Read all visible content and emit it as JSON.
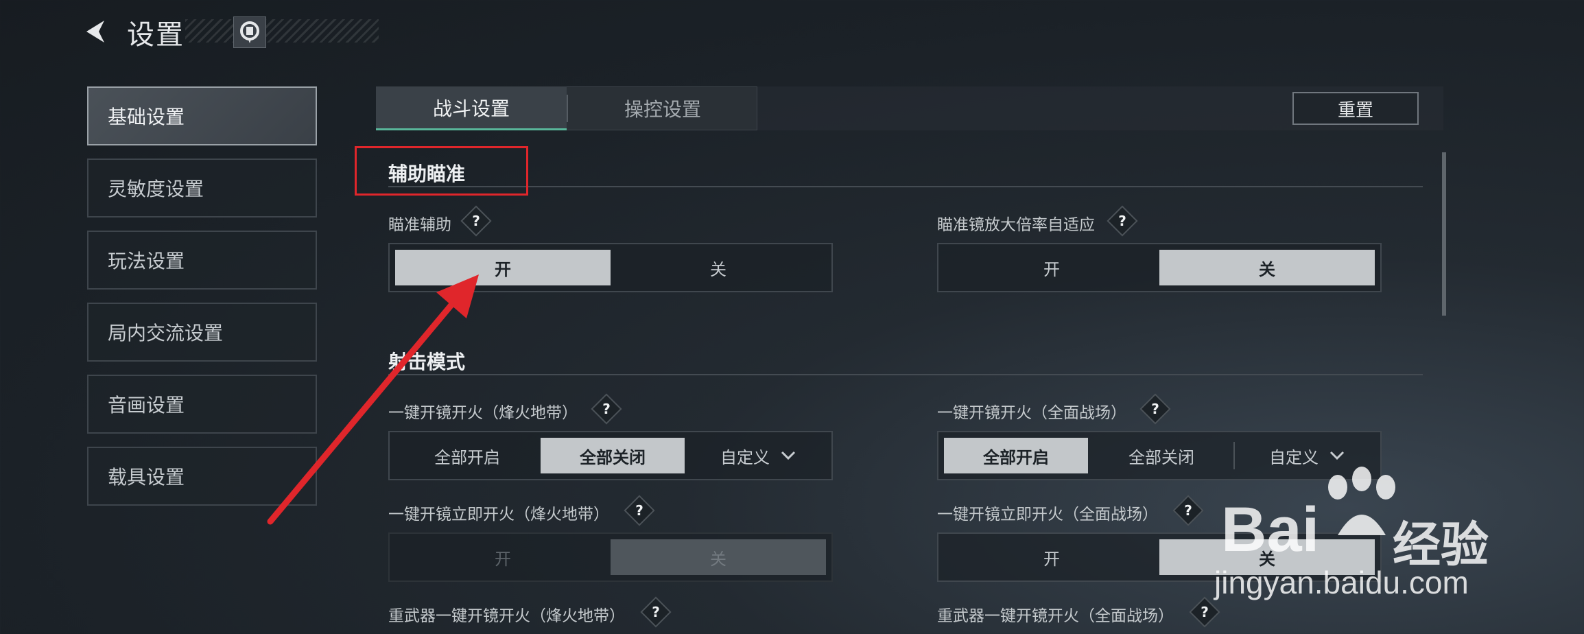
{
  "header": {
    "title": "设置"
  },
  "sidebar": {
    "items": [
      {
        "label": "基础设置"
      },
      {
        "label": "灵敏度设置"
      },
      {
        "label": "玩法设置"
      },
      {
        "label": "局内交流设置"
      },
      {
        "label": "音画设置"
      },
      {
        "label": "载具设置"
      }
    ]
  },
  "tabs": {
    "battle": "战斗设置",
    "control": "操控设置",
    "reset": "重置"
  },
  "sections": {
    "aim": {
      "title": "辅助瞄准",
      "aim_assist": {
        "label": "瞄准辅助",
        "on": "开",
        "off": "关",
        "selected": "开"
      },
      "scope_adapt": {
        "label": "瞄准镜放大倍率自适应",
        "on": "开",
        "off": "关",
        "selected": "关"
      }
    },
    "fire": {
      "title": "射击模式",
      "quick_fire_fh": {
        "label": "一键开镜开火（烽火地带）",
        "opt1": "全部开启",
        "opt2": "全部关闭",
        "opt3": "自定义",
        "selected": "全部关闭"
      },
      "quick_fire_qm": {
        "label": "一键开镜开火（全面战场）",
        "opt1": "全部开启",
        "opt2": "全部关闭",
        "opt3": "自定义",
        "selected": "全部开启"
      },
      "instant_fire_fh": {
        "label": "一键开镜立即开火（烽火地带）",
        "on": "开",
        "off": "关",
        "selected": "关"
      },
      "instant_fire_qm": {
        "label": "一键开镜立即开火（全面战场）",
        "on": "开",
        "off": "关",
        "selected": "关"
      },
      "heavy_fh": {
        "label": "重武器一键开镜开火（烽火地带）"
      },
      "heavy_qm": {
        "label": "重武器一键开镜开火（全面战场）"
      }
    },
    "help_mark": "?"
  },
  "watermark": {
    "brand": "Bai",
    "brand2": "经验",
    "url": "jingyan.baidu.com"
  },
  "colors": {
    "accent": "#59b69a",
    "highlight": "#e0262b",
    "selected_bg": "#c3c7ca"
  }
}
